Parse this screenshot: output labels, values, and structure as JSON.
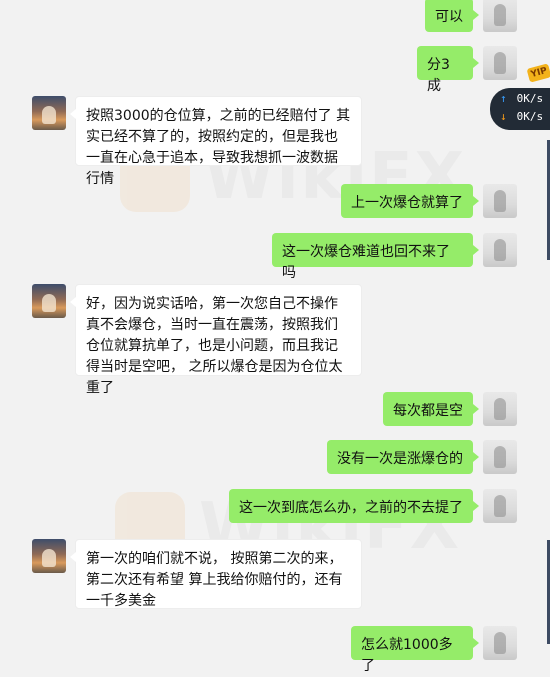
{
  "messages": [
    {
      "sender": "self",
      "text": "可以"
    },
    {
      "sender": "self",
      "text": "分3成"
    },
    {
      "sender": "other",
      "text": "按照3000的仓位算，之前的已经赔付了 其实已经不算了的，按照约定的，但是我也一直在心急于追本，导致我想抓一波数据行情"
    },
    {
      "sender": "self",
      "text": "上一次爆仓就算了"
    },
    {
      "sender": "self",
      "text": "这一次爆仓难道也回不来了吗"
    },
    {
      "sender": "other",
      "text": "好，因为说实话哈，第一次您自己不操作 真不会爆仓，当时一直在震荡，按照我们仓位就算抗单了，也是小问题，而且我记得当时是空吧，  之所以爆仓是因为仓位太重了"
    },
    {
      "sender": "self",
      "text": "每次都是空"
    },
    {
      "sender": "self",
      "text": "没有一次是涨爆仓的"
    },
    {
      "sender": "self",
      "text": "这一次到底怎么办，之前的不去提了"
    },
    {
      "sender": "other",
      "text": "第一次的咱们就不说，  按照第二次的来，第二次还有希望 算上我给你赔付的，还有一千多美金"
    },
    {
      "sender": "self",
      "text": "怎么就1000多了"
    }
  ],
  "watermark": {
    "text": "WikiFX"
  },
  "speed_widget": {
    "up": "0K/s",
    "down": "0K/s",
    "badge": "YIP"
  }
}
